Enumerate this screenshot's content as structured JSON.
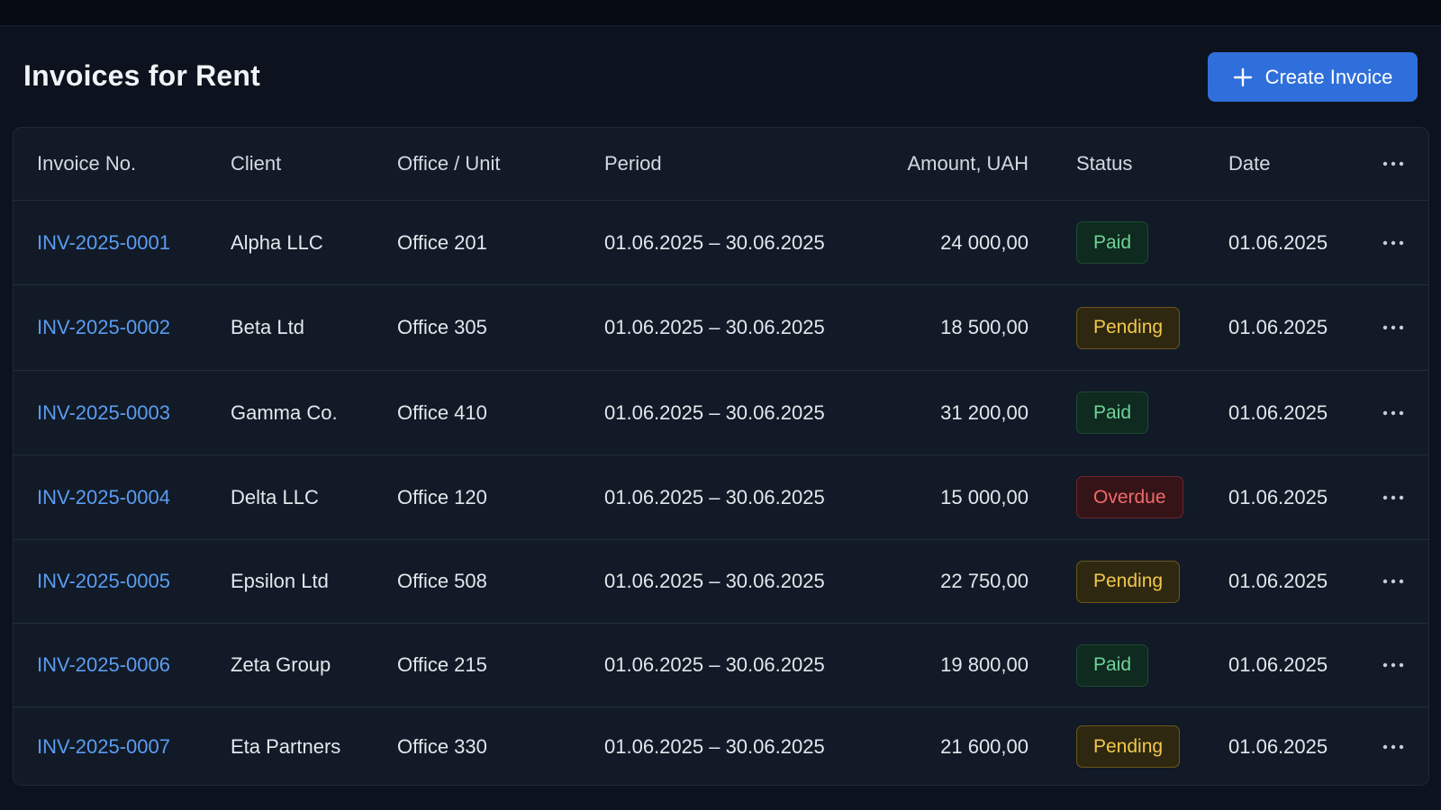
{
  "page": {
    "title": "Invoices for Rent"
  },
  "toolbar": {
    "create_label": "Create Invoice",
    "create_icon": "plus-icon"
  },
  "table": {
    "headers": {
      "invoice_no": "Invoice No.",
      "client": "Client",
      "office": "Office / Unit",
      "period": "Period",
      "amount": "Amount, UAH",
      "status": "Status",
      "date": "Date",
      "more_icon": "more-horizontal-icon"
    },
    "rows": [
      {
        "invoice_no": "INV-2025-0001",
        "client": "Alpha LLC",
        "office": "Office 201",
        "period": "01.06.2025 – 30.06.2025",
        "amount": "24 000,00",
        "status": "Paid",
        "status_kind": "paid",
        "date": "01.06.2025"
      },
      {
        "invoice_no": "INV-2025-0002",
        "client": "Beta Ltd",
        "office": "Office 305",
        "period": "01.06.2025 – 30.06.2025",
        "amount": "18 500,00",
        "status": "Pending",
        "status_kind": "pending",
        "date": "01.06.2025"
      },
      {
        "invoice_no": "INV-2025-0003",
        "client": "Gamma Co.",
        "office": "Office 410",
        "period": "01.06.2025 – 30.06.2025",
        "amount": "31 200,00",
        "status": "Paid",
        "status_kind": "paid",
        "date": "01.06.2025"
      },
      {
        "invoice_no": "INV-2025-0004",
        "client": "Delta LLC",
        "office": "Office 120",
        "period": "01.06.2025 – 30.06.2025",
        "amount": "15 000,00",
        "status": "Overdue",
        "status_kind": "overdue",
        "date": "01.06.2025"
      },
      {
        "invoice_no": "INV-2025-0005",
        "client": "Epsilon Ltd",
        "office": "Office 508",
        "period": "01.06.2025 – 30.06.2025",
        "amount": "22 750,00",
        "status": "Pending",
        "status_kind": "pending",
        "date": "01.06.2025"
      },
      {
        "invoice_no": "INV-2025-0006",
        "client": "Zeta Group",
        "office": "Office 215",
        "period": "01.06.2025 – 30.06.2025",
        "amount": "19 800,00",
        "status": "Paid",
        "status_kind": "paid",
        "date": "01.06.2025"
      },
      {
        "invoice_no": "INV-2025-0007",
        "client": "Eta Partners",
        "office": "Office 330",
        "period": "01.06.2025 – 30.06.2025",
        "amount": "21 600,00",
        "status": "Pending",
        "status_kind": "pending",
        "date": "01.06.2025"
      }
    ]
  },
  "colors": {
    "background": "#0c131e",
    "card": "#111a26",
    "accent": "#2f6fdb",
    "link": "#5b9cf2",
    "paid": "#6fd39a",
    "pending": "#f2c84b",
    "overdue": "#f26a6a"
  }
}
